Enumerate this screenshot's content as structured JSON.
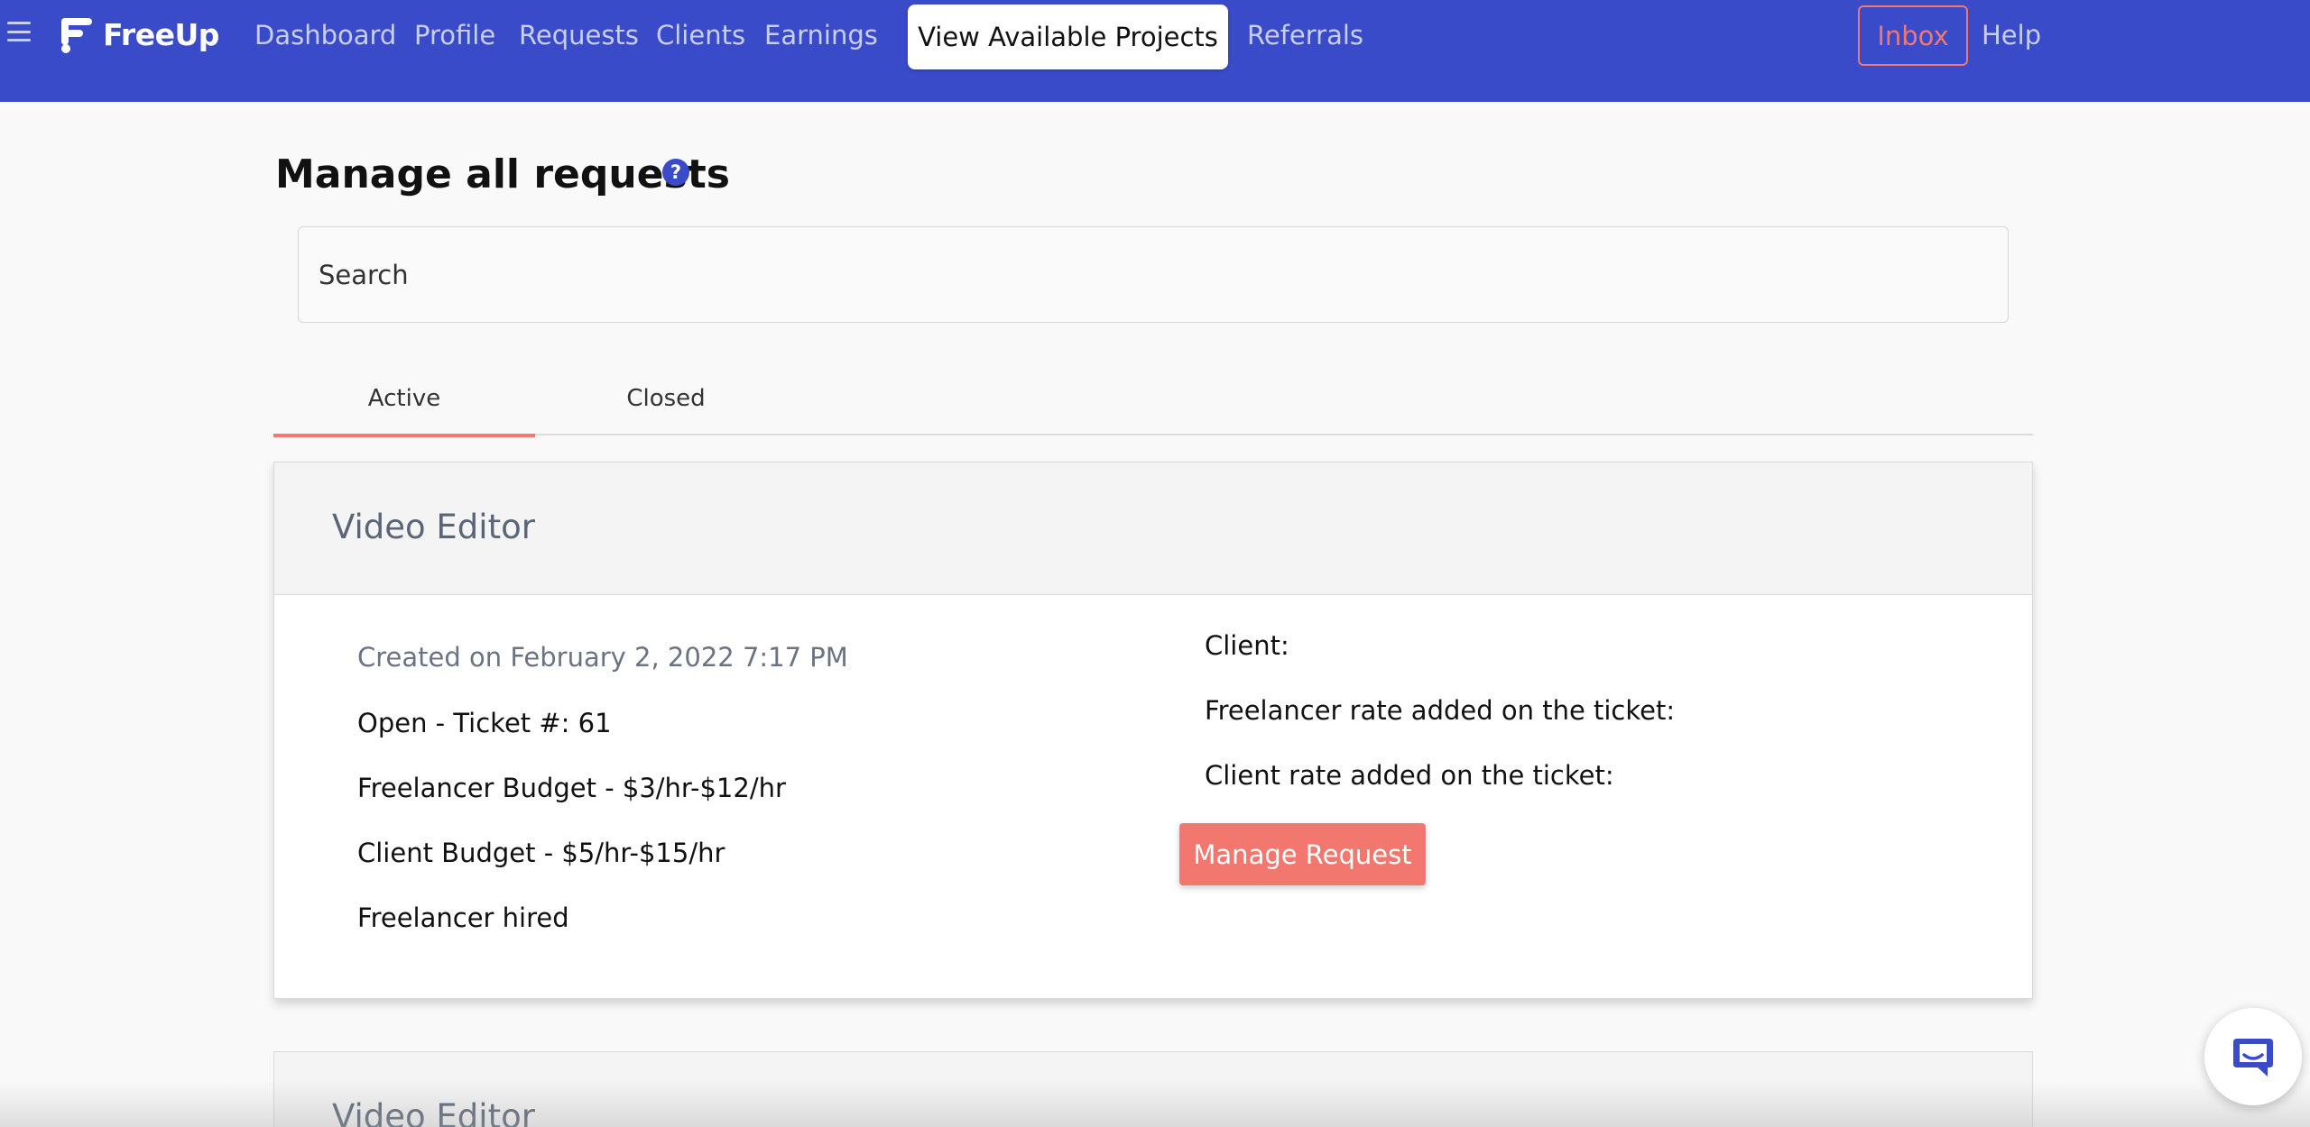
{
  "nav": {
    "brand": "FreeUp",
    "links": {
      "dashboard": "Dashboard",
      "profile": "Profile",
      "requests": "Requests",
      "clients": "Clients",
      "earnings": "Earnings",
      "referrals": "Referrals",
      "help": "Help"
    },
    "cta": "View Available Projects",
    "inbox": "Inbox"
  },
  "page": {
    "title": "Manage all requests",
    "help_icon": "question-circle-icon"
  },
  "search": {
    "placeholder": "Search",
    "value": ""
  },
  "tabs": {
    "active": "Active",
    "closed": "Closed"
  },
  "requests": [
    {
      "title": "Video Editor",
      "created": "Created on February 2, 2022 7:17 PM",
      "status": "Open - Ticket #: 61",
      "freelancer_budget": "Freelancer Budget - $3/hr-$12/hr",
      "client_budget": "Client Budget - $5/hr-$15/hr",
      "hire_status": "Freelancer hired",
      "client_label": "Client:",
      "freelancer_rate_label": "Freelancer rate added on the ticket:",
      "client_rate_label": "Client rate added on the ticket:",
      "action": "Manage Request"
    },
    {
      "title": "Video Editor"
    }
  ],
  "colors": {
    "nav_bg": "#3a4bca",
    "accent": "#f2776e",
    "muted_text": "#5a6678"
  },
  "chat_icon": "chat-bubble-icon"
}
